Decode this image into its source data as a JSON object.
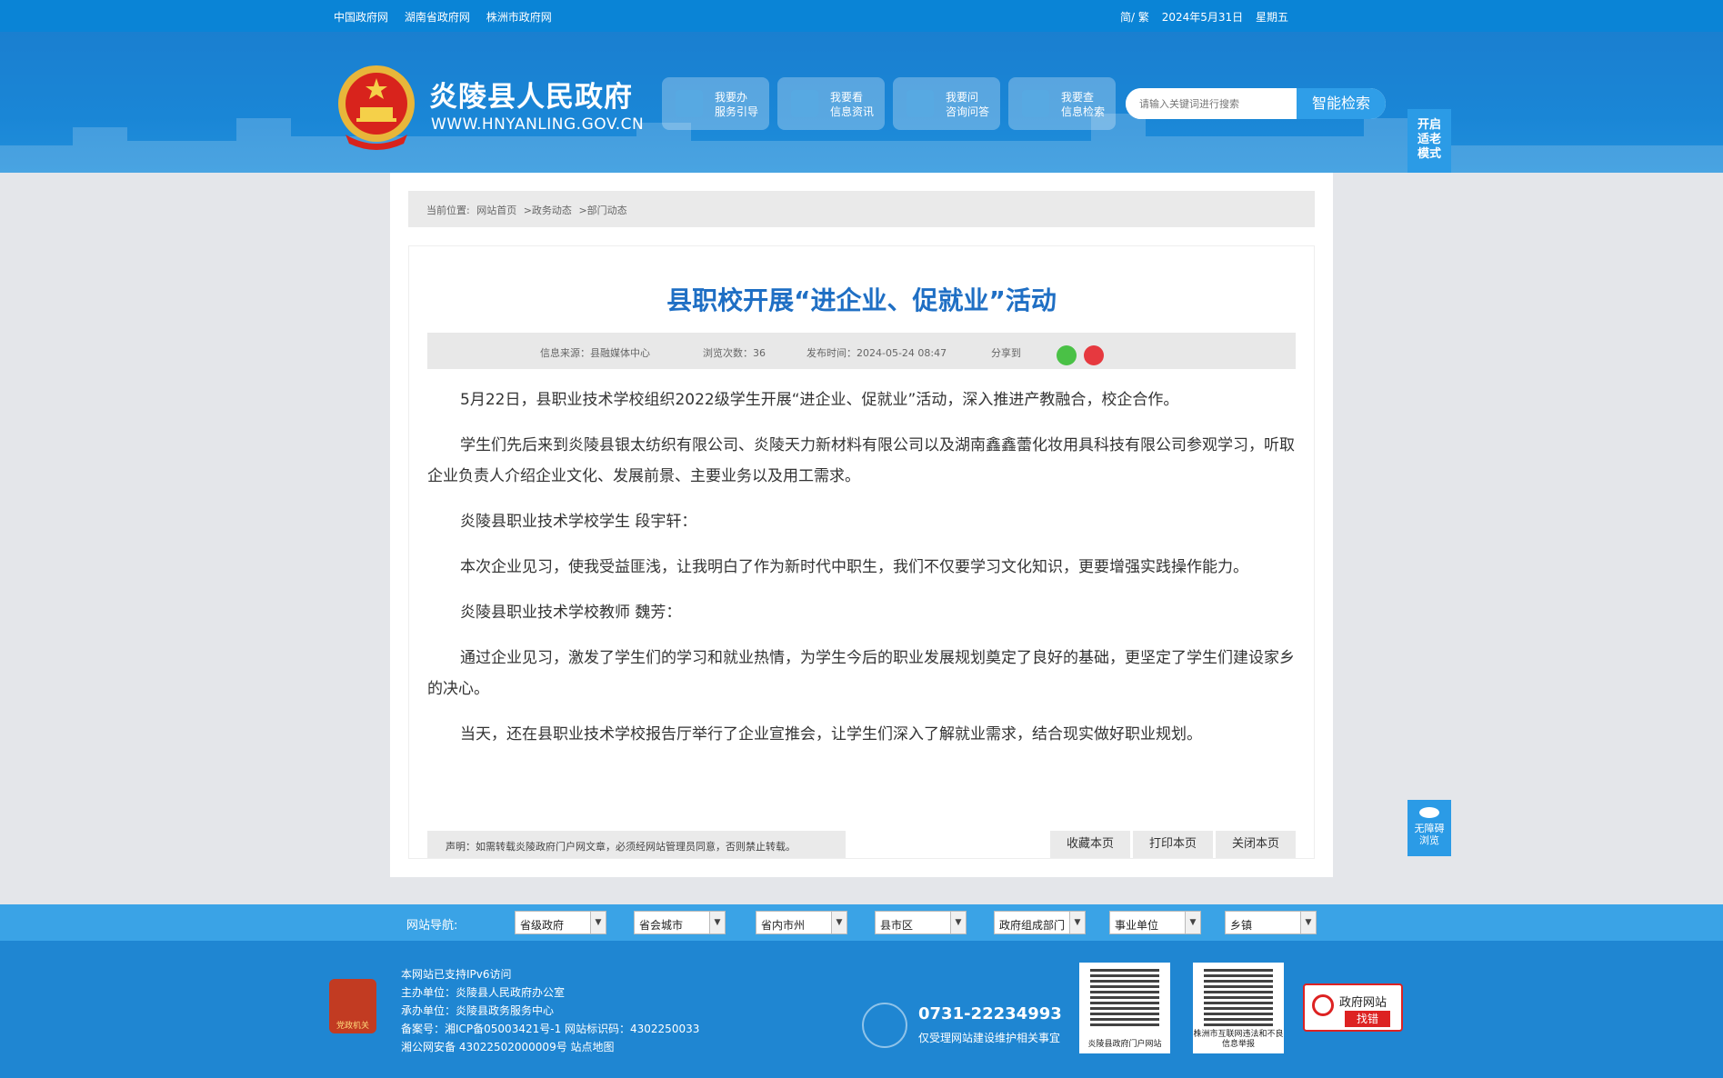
{
  "topbar": {
    "links": [
      "中国政府网",
      "湖南省政府网",
      "株洲市政府网"
    ],
    "lang": "简/ 繁",
    "date": "2024年5月31日",
    "weekday": "星期五"
  },
  "header": {
    "site_name": "炎陵县人民政府",
    "site_url": "WWW.HNYANLING.GOV.CN",
    "buttons": [
      {
        "line1": "我要办",
        "line2": "服务引导",
        "icon": "document-icon"
      },
      {
        "line1": "我要看",
        "line2": "信息资讯",
        "icon": "eye-icon"
      },
      {
        "line1": "我要问",
        "line2": "咨询问答",
        "icon": "question-icon"
      },
      {
        "line1": "我要查",
        "line2": "信息检索",
        "icon": "search-icon"
      }
    ],
    "search_placeholder": "请输入关键词进行搜索",
    "search_button": "智能检索",
    "elder_mode": "开启适老模式"
  },
  "breadcrumb": {
    "label": "当前位置:",
    "items": [
      "网站首页",
      ">政务动态",
      ">部门动态"
    ]
  },
  "article": {
    "title": "县职校开展“进企业、促就业”活动",
    "source": "信息来源：县融媒体中心",
    "views": "浏览次数：36",
    "published": "发布时间：2024-05-24 08:47",
    "share_label": "分享到",
    "paragraphs": [
      "5月22日，县职业技术学校组织2022级学生开展“进企业、促就业”活动，深入推进产教融合，校企合作。",
      "学生们先后来到炎陵县银太纺织有限公司、炎陵天力新材料有限公司以及湖南鑫鑫蕾化妆用具科技有限公司参观学习，听取企业负责人介绍企业文化、发展前景、主要业务以及用工需求。",
      "炎陵县职业技术学校学生 段宇轩：",
      "本次企业见习，使我受益匪浅，让我明白了作为新时代中职生，我们不仅要学习文化知识，更要增强实践操作能力。",
      "炎陵县职业技术学校教师 魏芳：",
      "通过企业见习，激发了学生们的学习和就业热情，为学生今后的职业发展规划奠定了良好的基础，更坚定了学生们建设家乡的决心。",
      "当天，还在县职业技术学校报告厅举行了企业宣推会，让学生们深入了解就业需求，结合现实做好职业规划。"
    ],
    "statement": "声明：如需转载炎陵政府门户网文章，必须经网站管理员同意，否则禁止转载。",
    "actions": [
      "收藏本页",
      "打印本页",
      "关闭本页"
    ]
  },
  "accessibility": {
    "line1": "无障碍",
    "line2": "浏览"
  },
  "site_nav": {
    "label": "网站导航:",
    "selects": [
      "省级政府",
      "省会城市",
      "省内市州",
      "县市区",
      "政府组成部门",
      "事业单位",
      "乡镇"
    ]
  },
  "footer": {
    "badge": "党政机关",
    "info": [
      "本网站已支持IPv6访问",
      "主办单位：炎陵县人民政府办公室",
      "承办单位：炎陵县政务服务中心",
      "备案号：湘ICP备05003421号-1 网站标识码：4302250033",
      "湘公网安备 43022502000009号 站点地图"
    ],
    "phone": "0731-22234993",
    "phone_note": "仅受理网站建设维护相关事宜",
    "qr1_caption": "炎陵县政府门户网站",
    "qr2_caption": "株洲市互联网违法和不良信息举报",
    "report_title": "政府网站",
    "report_action": "找错"
  },
  "colors": {
    "brand": "#1a7fd0",
    "title": "#1f6fc4",
    "nav": "#3aa3e6",
    "footer": "#1f86d2"
  }
}
